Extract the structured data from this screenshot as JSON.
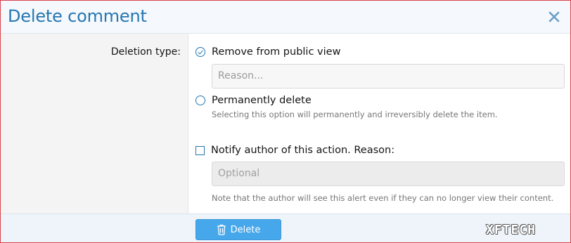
{
  "dialog": {
    "title": "Delete comment",
    "close_icon": "close-icon"
  },
  "form": {
    "deletion_type_label": "Deletion type:",
    "option_remove": {
      "label": "Remove from public view",
      "selected": true,
      "reason_placeholder": "Reason..."
    },
    "option_permanent": {
      "label": "Permanently delete",
      "selected": false,
      "hint": "Selecting this option will permanently and irreversibly delete the item."
    },
    "notify": {
      "label": "Notify author of this action. Reason:",
      "checked": false,
      "reason_placeholder": "Optional",
      "hint": "Note that the author will see this alert even if they can no longer view their content."
    }
  },
  "footer": {
    "delete_label": "Delete",
    "delete_icon": "trash-icon",
    "watermark": "XFTECH"
  },
  "colors": {
    "accent": "#2577b1",
    "button": "#47a7eb",
    "frame": "#d8434a"
  }
}
